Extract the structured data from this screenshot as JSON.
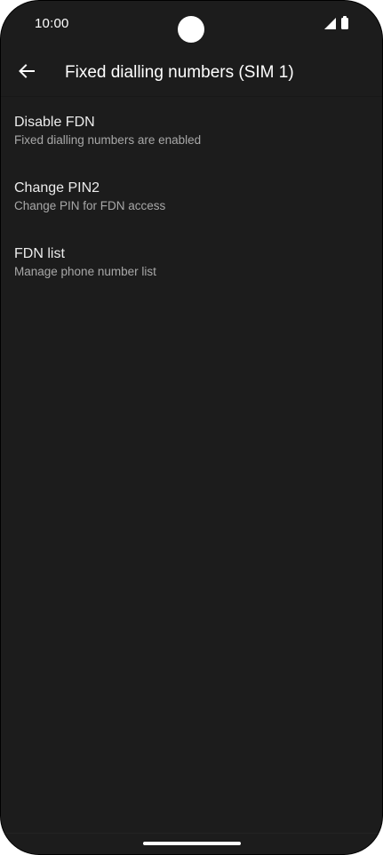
{
  "status_bar": {
    "time": "10:00",
    "icons": [
      "signal-icon",
      "battery-icon"
    ]
  },
  "app_bar": {
    "back_icon": "arrow-left-icon",
    "title": "Fixed dialling numbers (SIM 1)"
  },
  "preferences": [
    {
      "title": "Disable FDN",
      "summary": "Fixed dialling numbers are enabled"
    },
    {
      "title": "Change PIN2",
      "summary": "Change PIN for FDN access"
    },
    {
      "title": "FDN list",
      "summary": "Manage phone number list"
    }
  ],
  "colors": {
    "background": "#1c1c1c",
    "title_text": "#ececec",
    "summary_text": "#a8a8a8"
  }
}
